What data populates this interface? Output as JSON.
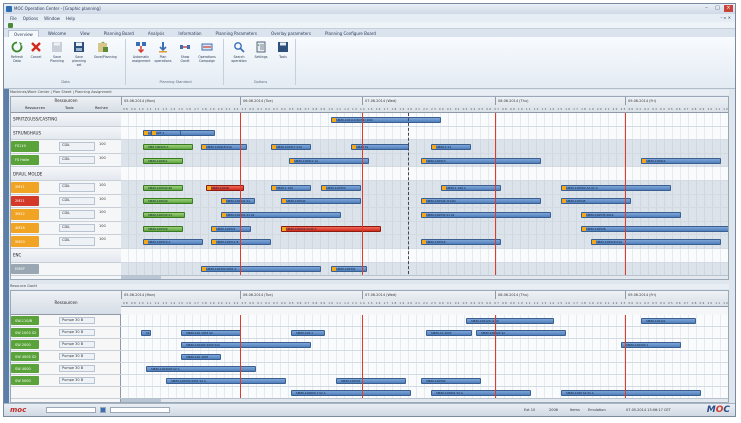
{
  "window": {
    "title": "MOC Operation Center - [Graphic planning]",
    "controls": [
      "–",
      "□",
      "×"
    ]
  },
  "menu": [
    "File",
    "Options",
    "Window",
    "Help"
  ],
  "menu_right": "– ▫ ×",
  "ribbon": {
    "tabs": [
      "Overview",
      "Welcome",
      "View",
      "Planning Board",
      "Analysis",
      "Information",
      "Planning Parameters",
      "Overlay parameters",
      "Planning Configure Board"
    ],
    "active_tab": 0,
    "groups": [
      {
        "label": "Data",
        "buttons": [
          "Refresh Data",
          "Cancel",
          "Save Planning",
          "Save planning set",
          "Save/Planning"
        ]
      },
      {
        "label": "Planning Standard",
        "buttons": [
          "Automatic assignment",
          "Plan operations",
          "Show Gantt",
          "Operations Campaign"
        ]
      },
      {
        "label": "Options",
        "buttons": [
          "Search operation",
          "Settings",
          "Tools"
        ]
      }
    ]
  },
  "top_panel": {
    "header": "Machines/Work Center | Plan Sheet | Planning Assignment",
    "resource_header": "Ressourcen",
    "subheads": [
      "Ressourcen",
      "Tools",
      "Rechen"
    ],
    "days": [
      "05.06.2014 (Mon)",
      "06.06.2014 (Tue)",
      "07.06.2014 (Wed)",
      "08.06.2014 (Thu)",
      "09.06.2014 (Fri)"
    ],
    "hours": "08 09 10 11 12 13 14 15 16 17 18 19 20 21 22 23 00 01 02 03 04 05 06 07 08 09 10 11 12 13 14 15 16 17 18 19 20 21 22 23 00 01 02 03 04 05 06 07 08 09 10 11 12 13 14 15 16 17 18 19 20 21 22 23 00 01 02 03 04 05 06 07 08 09 10 11 12 13 14 15 16 17 18 19 20 21 22 23 00 01 02 03 04 05 06 07",
    "rows": [
      {
        "name": "SPRITZGUSS/CASTING",
        "type": "group"
      },
      {
        "name": "STRUNGHAUS",
        "type": "group"
      },
      {
        "name": "FS110",
        "chip": "green",
        "tools": "CDIL",
        "val": "100"
      },
      {
        "name": "FS Halle",
        "chip": "green",
        "tools": "CDIL",
        "val": "100"
      },
      {
        "name": "DRAUL MOLDE",
        "type": "group"
      },
      {
        "name": "2M11",
        "chip": "orange",
        "tools": "CDIL",
        "val": "100"
      },
      {
        "name": "2M21",
        "chip": "red",
        "tools": "CDIL",
        "val": "100"
      },
      {
        "name": "3M12",
        "chip": "orange",
        "tools": "CDIL",
        "val": "100"
      },
      {
        "name": "4M18",
        "chip": "orange",
        "tools": "CDIL",
        "val": "100"
      },
      {
        "name": "5M20",
        "chip": "orange",
        "tools": "CDIL",
        "val": "100"
      },
      {
        "name": "ENC",
        "type": "group"
      },
      {
        "name": "EMSP",
        "chip": "gray",
        "tools": "",
        "val": ""
      }
    ],
    "tasks": [
      {
        "row": 0,
        "label": "SMZ0-100110 ROHK (100)"
      },
      {
        "row": 1,
        "label": "12M0.13900 ROHK"
      },
      {
        "row": 1,
        "label": "OPF 1"
      },
      {
        "row": 2,
        "label": "SMZ 100920 A"
      },
      {
        "row": 2,
        "label": "SMZ0-100918 01A"
      },
      {
        "row": 2,
        "label": "SMZ0-100917 01A"
      },
      {
        "row": 2,
        "label": "SMZ0 S1"
      },
      {
        "row": 2,
        "label": "SMZ0-1 S1"
      },
      {
        "row": 3,
        "label": "SMZ0-100911"
      },
      {
        "row": 3,
        "label": "SMZ0-100912 1A"
      },
      {
        "row": 3,
        "label": "SMZ0-100913"
      },
      {
        "row": 3,
        "label": "SMZ0-100914"
      },
      {
        "row": 5,
        "label": "SMZ0-100540 60"
      },
      {
        "row": 5,
        "label": "SMZ0-10048"
      },
      {
        "row": 5,
        "label": "SMZ0-1 100"
      },
      {
        "row": 5,
        "label": "SMZ0-100550"
      },
      {
        "row": 5,
        "label": "SMZ0-1 100 A"
      },
      {
        "row": 5,
        "label": "SMZ0-100560 AA 01 A"
      },
      {
        "row": 6,
        "label": "SMZ0-100540"
      },
      {
        "row": 6,
        "label": "SMZ0-100541 01"
      },
      {
        "row": 6,
        "label": "SMZ0-100542"
      },
      {
        "row": 6,
        "label": "SMZ0-100544 (0140)"
      },
      {
        "row": 6,
        "label": "SMZ0-100545"
      },
      {
        "row": 7,
        "label": "SMZ0-100530 01"
      },
      {
        "row": 7,
        "label": "SMZ0-100531 01 01"
      },
      {
        "row": 7,
        "label": "SMZ0-100532 01 01"
      },
      {
        "row": 7,
        "label": "SMZ0-100535 0014"
      },
      {
        "row": 8,
        "label": "SMZ0-100520"
      },
      {
        "row": 8,
        "label": "SMZ0-100521"
      },
      {
        "row": 8,
        "label": "SMZ0-100524 0140 A"
      },
      {
        "row": 8,
        "label": "SMZ0-100526"
      },
      {
        "row": 9,
        "label": "SMZ0-100510 A"
      },
      {
        "row": 9,
        "label": "SMZ0-100511 B"
      },
      {
        "row": 9,
        "label": "SMZ0-100516"
      },
      {
        "row": 9,
        "label": "SMZ0-100518 01A"
      },
      {
        "row": 11,
        "label": "SMZ0-100300 0001 A"
      },
      {
        "row": 11,
        "label": "SMZ0-100301"
      }
    ]
  },
  "bottom_panel": {
    "header": "Resource Gantt",
    "resource_header": "Ressourcen",
    "days": [
      "05.06.2014 (Mon)",
      "06.06.2014 (Tue)",
      "07.06.2014 (Wed)",
      "08.06.2014 (Thu)",
      "09.06.2014 (Fri)"
    ],
    "rows": [
      {
        "name": "SW-110/B",
        "tools": "Pumpe 30 B",
        "chip": "green"
      },
      {
        "name": "SW 1003 S2",
        "tools": "Pumpe 30 B",
        "chip": "green"
      },
      {
        "name": "SW 2000",
        "tools": "Pumpe 30 B",
        "chip": "green"
      },
      {
        "name": "SW 4005 S2",
        "tools": "Pumpe 30 B",
        "chip": "green"
      },
      {
        "name": "SW 4000",
        "tools": "Pumpe 30 B",
        "chip": "green"
      },
      {
        "name": "SW 5000",
        "tools": "Pumpe 30 B",
        "chip": "green"
      },
      {
        "name": "",
        "tools": "",
        "chip": ""
      }
    ],
    "tasks": [
      {
        "row": 0,
        "label": "SMZ0-100120 (110)"
      },
      {
        "row": 0,
        "label": "SMZ0-100121"
      },
      {
        "row": 1,
        "label": "S1"
      },
      {
        "row": 1,
        "label": "SMZ0-100 1003 S2"
      },
      {
        "row": 1,
        "label": "SMZ0-100-1"
      },
      {
        "row": 1,
        "label": "SMZ0-10 1003"
      },
      {
        "row": 1,
        "label": "SMZ0-100122 S2"
      },
      {
        "row": 2,
        "label": "SMZ0-100200 2000 S2A"
      },
      {
        "row": 2,
        "label": "SMZ0-100200 1"
      },
      {
        "row": 3,
        "label": "SMZ0-100 4005"
      },
      {
        "row": 4,
        "label": "SMZ0-1004000 S2 A"
      },
      {
        "row": 5,
        "label": "SMZ0-100500 0001 S2 A"
      },
      {
        "row": 5,
        "label": "SMZ0-100501"
      },
      {
        "row": 5,
        "label": "SMZ0-100502"
      },
      {
        "row": 6,
        "label": "SMZ0-100600 1 S2 A"
      },
      {
        "row": 6,
        "label": "SMZ0-100601 S2 A"
      },
      {
        "row": 6,
        "label": "SMZ0-1006 S2 01 A"
      }
    ]
  },
  "status": {
    "logo": "moc",
    "items": [
      "Ext 10",
      "2006",
      "Items",
      "Emulation",
      "07.05.2014 13:06:17 CET"
    ],
    "brand": "MOC"
  },
  "colors": {
    "task_blue": "#5f8ec8",
    "task_red": "#d93a2a",
    "task_orange": "#f2a81a",
    "chip_green": "#5aa33a",
    "chip_orange": "#f1a423",
    "chip_red": "#d43a2a",
    "chip_gray": "#9aa6b2"
  }
}
